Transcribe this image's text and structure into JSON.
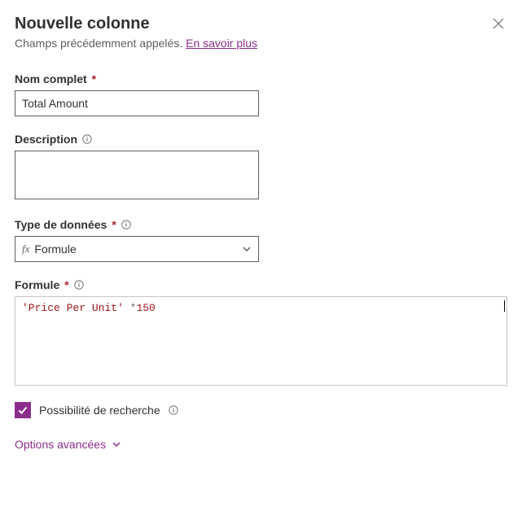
{
  "header": {
    "title": "Nouvelle colonne",
    "subtitle_prefix": "Champs précédemment appelés. ",
    "learn_more": "En savoir plus"
  },
  "fields": {
    "display_name": {
      "label": "Nom complet",
      "value": "Total Amount"
    },
    "description": {
      "label": "Description",
      "value": ""
    },
    "data_type": {
      "label": "Type de données",
      "selected": "Formule"
    },
    "formula": {
      "label": "Formule",
      "string_part": "'Price Per Unit'",
      "operator_part": " *",
      "number_part": "150",
      "raw": "'Price Per Unit' *150"
    },
    "searchable": {
      "label": "Possibilité de recherche",
      "checked": true
    }
  },
  "advanced": {
    "label": "Options avancées"
  }
}
